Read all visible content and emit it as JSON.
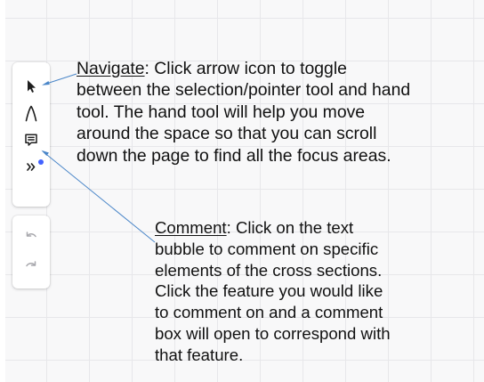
{
  "toolbar": {
    "tools": [
      {
        "name": "select-tool",
        "icon": "cursor-arrow-icon"
      },
      {
        "name": "pen-tool",
        "icon": "pen-icon"
      },
      {
        "name": "comment-tool",
        "icon": "comment-bubble-icon"
      },
      {
        "name": "more-tools",
        "icon": "double-chevron-icon",
        "has_indicator": true
      }
    ],
    "history": [
      {
        "name": "undo",
        "icon": "undo-icon"
      },
      {
        "name": "redo",
        "icon": "redo-icon"
      }
    ]
  },
  "annotations": {
    "navigate": {
      "title": "Navigate",
      "lines": [
        ": Click arrow icon to toggle",
        "between the selection/pointer tool and hand",
        "tool. The hand tool will help you move",
        "around the space so that you can scroll",
        "down the page to find all the focus areas."
      ]
    },
    "comment": {
      "title": "Comment",
      "lines": [
        ": Click on the text",
        "bubble to comment on  specific",
        "elements of the cross sections.",
        "Click the feature you would like",
        "to comment on and a comment",
        "box will open to correspond with",
        "that feature."
      ]
    }
  },
  "colors": {
    "accent": "#4262ff",
    "callout_line": "#4a86c8",
    "icon": "#1e1e1e",
    "icon_disabled": "#a8a8ad"
  }
}
